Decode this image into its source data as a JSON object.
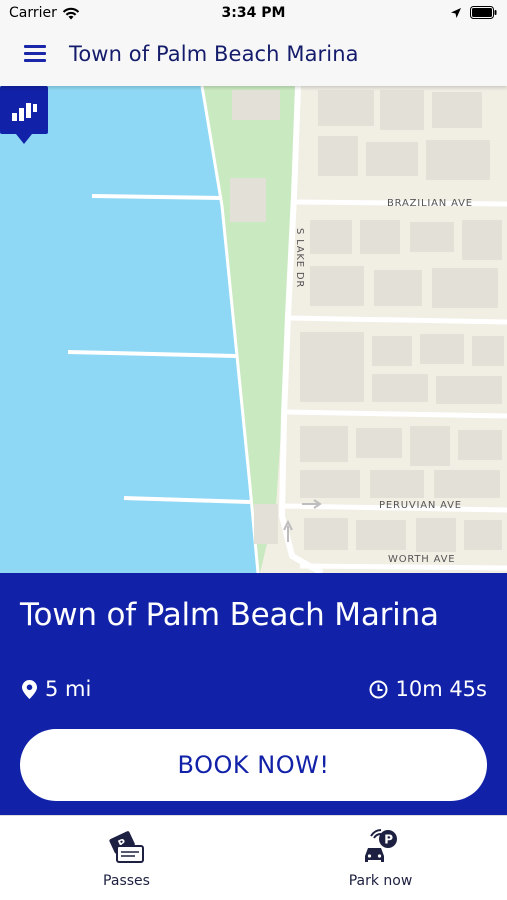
{
  "status_bar": {
    "carrier": "Carrier",
    "time": "3:34 PM"
  },
  "header": {
    "title": "Town of Palm Beach Marina",
    "menu_icon": "hamburger-menu-icon"
  },
  "map": {
    "streets": [
      "BRAZILIAN AVE",
      "S LAKE DR",
      "PERUVIAN AVE",
      "WORTH AVE"
    ],
    "colors": {
      "water": "#8fd8f5",
      "park": "#c9e9c0",
      "land": "#f1eee4",
      "road": "#ffffff",
      "building": "#e3e0d8"
    },
    "pin_icon": "marina-pin-icon"
  },
  "venue": {
    "name": "Town of Palm Beach Marina",
    "distance": "5 mi",
    "duration": "10m 45s",
    "book_label": "BOOK NOW!"
  },
  "tabs": [
    {
      "label": "Passes",
      "icon": "passes-ticket-icon"
    },
    {
      "label": "Park now",
      "icon": "park-now-car-icon"
    }
  ],
  "colors": {
    "primary": "#1222a8",
    "header_text": "#141c6b"
  }
}
